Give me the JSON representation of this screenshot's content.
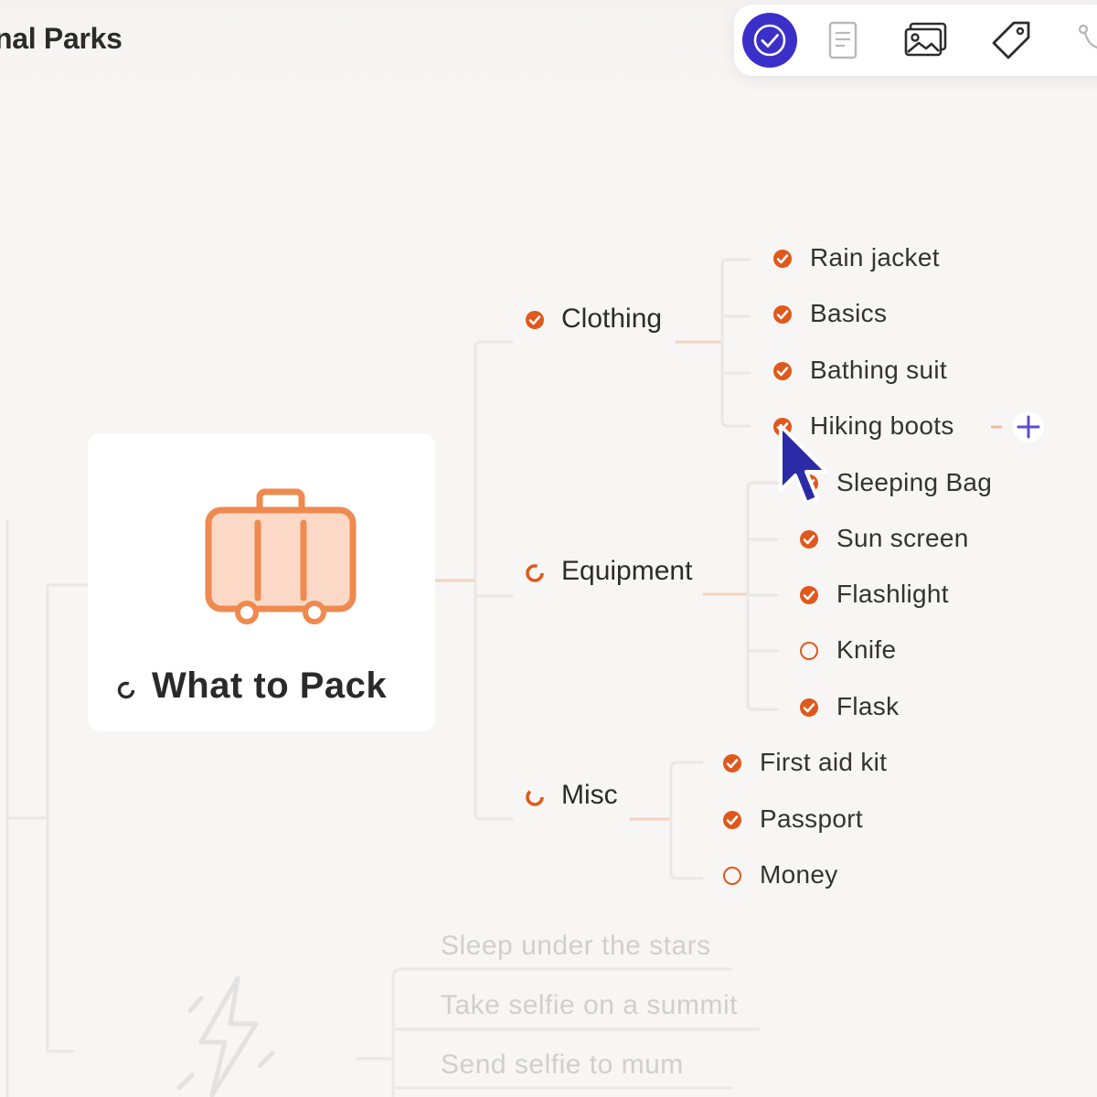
{
  "app": {
    "title": "nal Parks"
  },
  "toolbar": {
    "tools": [
      {
        "name": "task-checkbox-tool",
        "icon": "check-circle-icon",
        "active": true
      },
      {
        "name": "note-tool",
        "icon": "document-icon",
        "active": false
      },
      {
        "name": "image-tool",
        "icon": "image-icon",
        "active": false
      },
      {
        "name": "tag-tool",
        "icon": "tag-icon",
        "active": false
      },
      {
        "name": "relationship-tool",
        "icon": "connector-icon",
        "active": false
      }
    ],
    "active_color": "#3b2fc9"
  },
  "mindmap": {
    "root": {
      "label": "What to Pack",
      "icon": "suitcase-icon",
      "status": "partial"
    },
    "branches": [
      {
        "label": "Clothing",
        "status": "done",
        "children": [
          {
            "label": "Rain jacket",
            "status": "done"
          },
          {
            "label": "Basics",
            "status": "done"
          },
          {
            "label": "Bathing suit",
            "status": "done"
          },
          {
            "label": "Hiking boots",
            "status": "done"
          }
        ]
      },
      {
        "label": "Equipment",
        "status": "partial",
        "children": [
          {
            "label": "Sleeping Bag",
            "status": "done"
          },
          {
            "label": "Sun screen",
            "status": "done"
          },
          {
            "label": "Flashlight",
            "status": "done"
          },
          {
            "label": "Knife",
            "status": "todo"
          },
          {
            "label": "Flask",
            "status": "done"
          }
        ]
      },
      {
        "label": "Misc",
        "status": "partial",
        "children": [
          {
            "label": "First aid kit",
            "status": "done"
          },
          {
            "label": "Passport",
            "status": "done"
          },
          {
            "label": "Money",
            "status": "todo"
          }
        ]
      }
    ],
    "faded_items": [
      {
        "label": "Sleep under the stars"
      },
      {
        "label": "Take selfie on a summit"
      },
      {
        "label": "Send selfie to mum"
      }
    ],
    "faded_icon": "lightning-icon"
  },
  "colors": {
    "accent": "#e0581c",
    "connector": "#ebe7e3",
    "connector_highlight": "#f6d2c0",
    "add_button": "#5a4fcf"
  }
}
